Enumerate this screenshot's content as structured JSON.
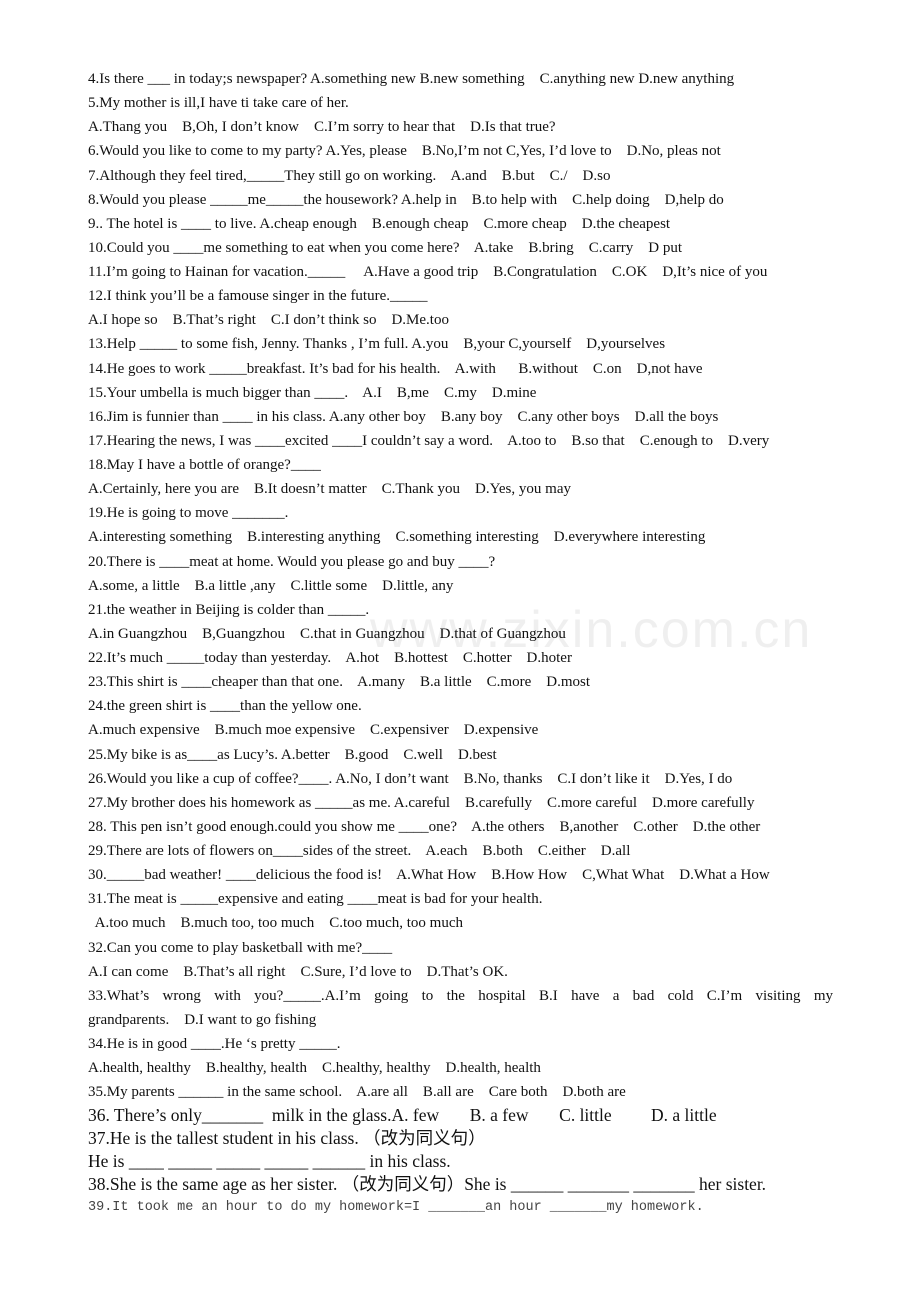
{
  "watermark": "www.zixin.com.cn",
  "small_lines": [
    "4.Is there ___ in today;s newspaper? A.something new B.new something    C.anything new D.new anything",
    "5.My mother is ill,I have ti take care of her.",
    "A.Thang you    B,Oh, I don’t know    C.I’m sorry to hear that    D.Is that true?",
    "6.Would you like to come to my party? A.Yes, please    B.No,I’m not C,Yes, I’d love to    D.No, pleas not",
    "7.Although they feel tired,_____They still go on working.    A.and    B.but    C./    D.so",
    "8.Would you please _____me_____the housework? A.help in    B.to help with    C.help doing    D,help do",
    "9.. The hotel is ____ to live. A.cheap enough    B.enough cheap    C.more cheap    D.the cheapest",
    "10.Could you ____me something to eat when you come here?    A.take    B.bring    C.carry    D put",
    "11.I’m going to Hainan for vacation._____     A.Have a good trip    B.Congratulation    C.OK    D,It’s nice of you",
    "12.I think you’ll be a famouse singer in the future._____",
    "A.I hope so    B.That’s right    C.I don’t think so    D.Me.too",
    "13.Help _____ to some fish, Jenny. Thanks , I’m full. A.you    B,your C,yourself    D,yourselves",
    "14.He goes to work _____breakfast. It’s bad for his health.    A.with      B.without    C.on    D,not have",
    "15.Your umbella is much bigger than ____.    A.I    B,me    C.my    D.mine",
    "16.Jim is funnier than ____ in his class. A.any other boy    B.any boy    C.any other boys    D.all the boys",
    "17.Hearing the news, I was ____excited ____I couldn’t say a word.    A.too to    B.so that    C.enough to    D.very",
    "18.May I have a bottle of orange?____",
    "A.Certainly, here you are    B.It doesn’t matter    C.Thank you    D.Yes, you may",
    "19.He is going to move _______.",
    "A.interesting something    B.interesting anything    C.something interesting    D.everywhere interesting",
    "20.There is ____meat at home. Would you please go and buy ____?",
    "A.some, a little    B.a little ,any    C.little some    D.little, any",
    "21.the weather in Beijing is colder than _____.",
    "A.in Guangzhou    B,Guangzhou    C.that in Guangzhou    D.that of Guangzhou",
    "22.It’s much _____today than yesterday.    A.hot    B.hottest    C.hotter    D.hoter",
    "23.This shirt is ____cheaper than that one.    A.many    B.a little    C.more    D.most",
    "24.the green shirt is ____than the yellow one.",
    "A.much expensive    B.much moe expensive    C.expensiver    D.expensive",
    "25.My bike is as____as Lucy’s. A.better    B.good    C.well    D.best",
    "26.Would you like a cup of coffee?____. A.No, I don’t want    B.No, thanks    C.I don’t like it    D.Yes, I do",
    "27.My brother does his homework as _____as me. A.careful    B.carefully    C.more careful    D.more carefully",
    "28. This pen isn’t good enough.could you show me ____one?    A.the others    B,another    C.other    D.the other",
    "29.There are lots of flowers on____sides of the street.    A.each    B.both    C.either    D.all",
    "30._____bad weather! ____delicious the food is!    A.What How    B.How How    C,What What    D.What a How",
    "31.The meat is _____expensive and eating ____meat is bad for your health.",
    "  A.too much    B.much too, too much    C.too much, too much",
    "32.Can you come to play basketball with me?____",
    "A.I can come    B.That’s all right    C.Sure, I’d love to    D.That’s OK.",
    "33.What’s wrong with you?_____.A.I’m going to the hospital B.I have a bad cold C.I’m visiting my",
    "grandparents.    D.I want to go fishing",
    "34.He is in good ____.He ‘s pretty _____.",
    "A.health, healthy    B.healthy, health    C.healthy, healthy    D.health, health",
    "35.My parents ______ in the same school.    A.are all    B.all are    Care both    D.both are"
  ],
  "large_lines": [
    "36. There’s only_______  milk in the glass.A. few       B. a few       C. little         D. a little",
    "37.He is the tallest student in his class. （改为同义句）",
    "He is ____ _____ _____ _____ ______ in his class.",
    "38.She is the same age as her sister. （改为同义句）She is ______ _______ _______ her sister."
  ],
  "mono_line": "39.It took me an hour to do my homework=I _______an hour _______my homework."
}
